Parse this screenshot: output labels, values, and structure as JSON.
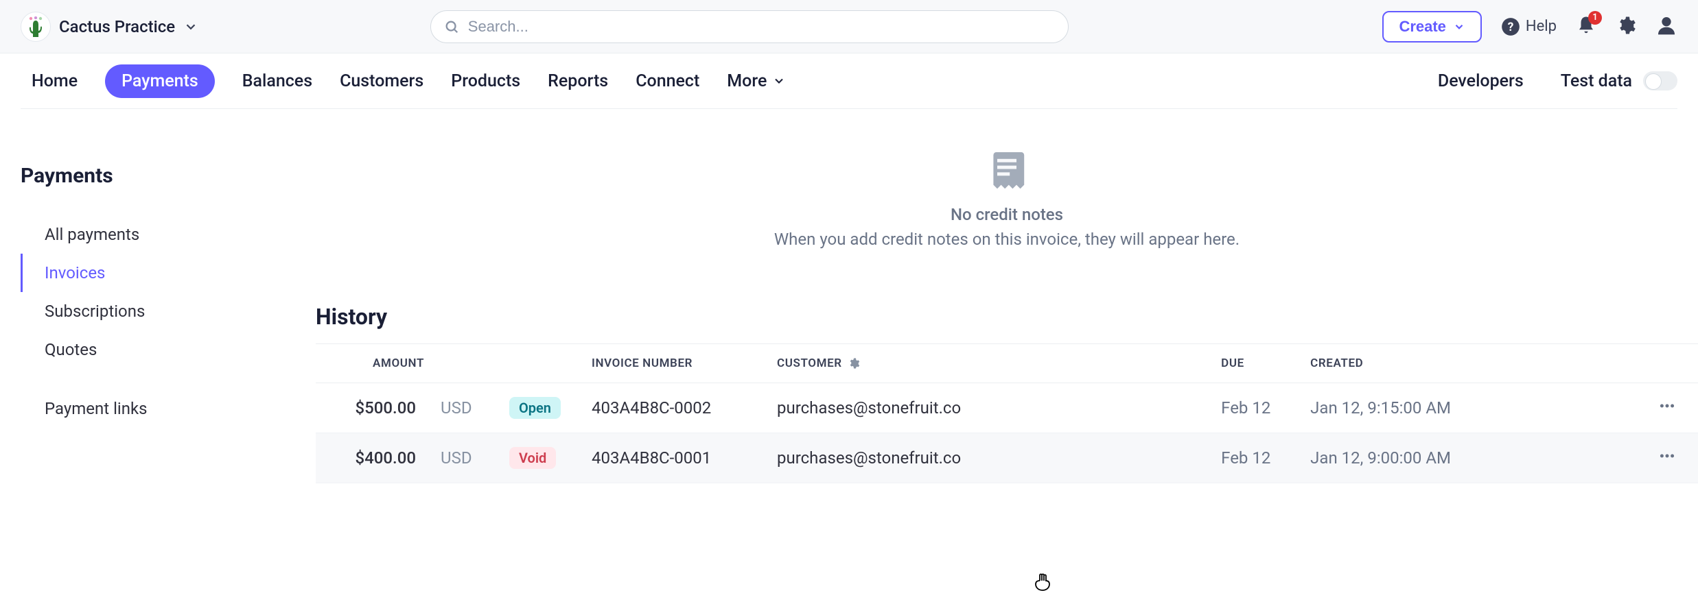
{
  "topbar": {
    "org_name": "Cactus Practice",
    "search_placeholder": "Search...",
    "create_label": "Create",
    "help_label": "Help",
    "notification_count": "1"
  },
  "nav": {
    "items": [
      "Home",
      "Payments",
      "Balances",
      "Customers",
      "Products",
      "Reports",
      "Connect",
      "More"
    ],
    "active_index": 1,
    "right": {
      "developers": "Developers",
      "test_data": "Test data"
    }
  },
  "sidebar": {
    "title": "Payments",
    "items": [
      {
        "label": "All payments"
      },
      {
        "label": "Invoices",
        "active": true
      },
      {
        "label": "Subscriptions"
      },
      {
        "label": "Quotes"
      }
    ],
    "links": [
      {
        "label": "Payment links"
      }
    ]
  },
  "empty_state": {
    "title": "No credit notes",
    "subtitle": "When you add credit notes on this invoice, they will appear here."
  },
  "history": {
    "title": "History",
    "columns": {
      "amount": "Amount",
      "invoice_number": "Invoice number",
      "customer": "Customer",
      "due": "Due",
      "created": "Created"
    },
    "rows": [
      {
        "amount": "$500.00",
        "currency": "USD",
        "status": "Open",
        "status_kind": "open",
        "invoice_number": "403A4B8C-0002",
        "customer": "purchases@stonefruit.co",
        "due": "Feb 12",
        "created": "Jan 12, 9:15:00 AM"
      },
      {
        "amount": "$400.00",
        "currency": "USD",
        "status": "Void",
        "status_kind": "void",
        "invoice_number": "403A4B8C-0001",
        "customer": "purchases@stonefruit.co",
        "due": "Feb 12",
        "created": "Jan 12, 9:00:00 AM"
      }
    ]
  }
}
